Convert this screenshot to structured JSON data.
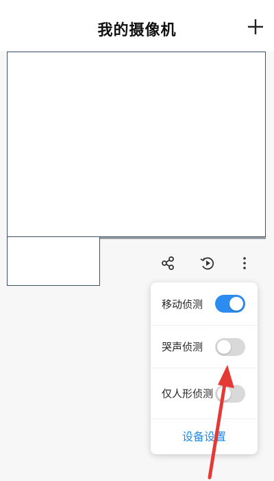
{
  "header": {
    "title": "我的摄像机",
    "add_icon": "plus-icon"
  },
  "camera": {
    "actions": [
      {
        "name": "share-icon"
      },
      {
        "name": "playback-icon"
      },
      {
        "name": "more-vertical-icon"
      }
    ]
  },
  "menu": {
    "items": [
      {
        "label": "移动侦测",
        "enabled": true
      },
      {
        "label": "哭声侦测",
        "enabled": false
      },
      {
        "label": "仅人形侦测",
        "enabled": false
      }
    ],
    "settings_label": "设备设置"
  },
  "colors": {
    "accent": "#2d8cf0",
    "link": "#1e88e5",
    "annotation_arrow": "#e53935"
  }
}
